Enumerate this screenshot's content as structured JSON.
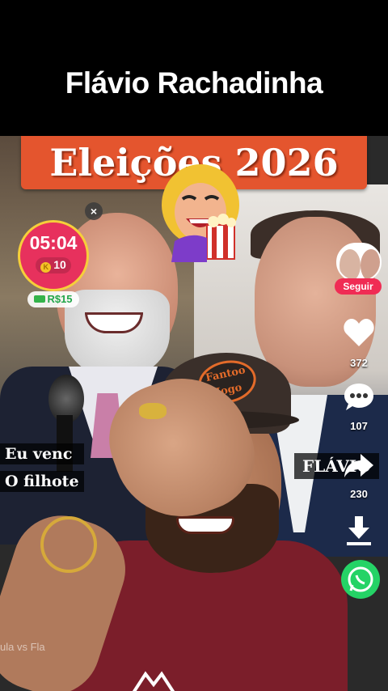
{
  "header": {
    "title": "Flávio Rachadinha"
  },
  "banner": {
    "text": "Eleições 2026"
  },
  "timer": {
    "time": "05:04",
    "coins": "10",
    "close": "×"
  },
  "reward_badge": {
    "amount": "R$15"
  },
  "cap_logo": {
    "line1": "Fantoo",
    "line2": "Jogo"
  },
  "rail": {
    "follow_label": "Seguir",
    "likes": "372",
    "comments": "107",
    "shares": "230"
  },
  "captions": {
    "line1": "Eu venc",
    "line2": "O filhote"
  },
  "right_label": "FLÁVIO",
  "bottom_text": "ula vs Fla",
  "colors": {
    "banner": "#e4552e",
    "timer_bg": "#e7315d",
    "timer_ring": "#f6cf3a",
    "follow": "#f02c54",
    "whatsapp": "#25d366",
    "shirt": "#7b1e2a"
  },
  "icons": [
    "close-icon",
    "coin-icon",
    "cash-icon",
    "heart-icon",
    "comment-icon",
    "share-icon",
    "download-icon",
    "whatsapp-icon"
  ]
}
